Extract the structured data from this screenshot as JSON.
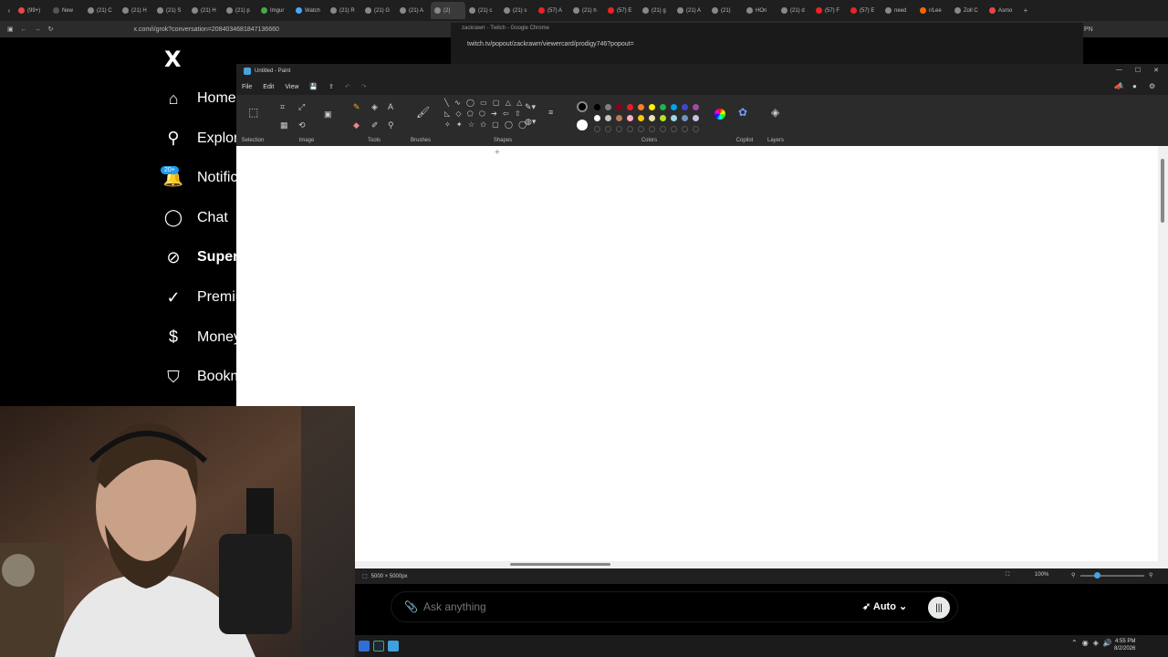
{
  "browser": {
    "tabs": [
      "(99+)",
      "New",
      "(21) C",
      "(21) H",
      "(21) S",
      "(21) H",
      "(21) p",
      "Imgur",
      "Watch",
      "(21) R",
      "(21) G",
      "(21) A",
      "(2)",
      "(21) c",
      "(21) s",
      "(57) A",
      "(21) h",
      "(57) E",
      "(21) g",
      "(21) A",
      "(21)",
      "HOn",
      "(21) d",
      "(57) F",
      "(57) E",
      "need",
      "r/Lee",
      "Zoll C",
      "Asmo"
    ],
    "active_tab_index": 12,
    "url": "x.com/i/grok?conversation=2084034681847136660",
    "profile": "PN"
  },
  "twitch_popout": {
    "title": "zackrawrr - Twitch - Google Chrome",
    "url": "twitch.tv/popout/zackrawrr/viewercard/prodigy746?popout="
  },
  "x_sidebar": {
    "logo": "X",
    "items": [
      {
        "label": "Home",
        "icon": "home-icon"
      },
      {
        "label": "Explor",
        "icon": "search-icon"
      },
      {
        "label": "Notific",
        "icon": "bell-icon"
      },
      {
        "label": "Chat",
        "icon": "chat-icon"
      },
      {
        "label": "Super",
        "icon": "grok-icon"
      },
      {
        "label": "Premiu",
        "icon": "verified-icon"
      },
      {
        "label": "Money",
        "icon": "dollar-icon"
      },
      {
        "label": "Bookm",
        "icon": "bookmark-icon"
      }
    ],
    "notification_badge": "20+"
  },
  "paint": {
    "window_title": "Untitled - Paint",
    "menu": [
      "File",
      "Edit",
      "View"
    ],
    "ribbon_groups": [
      "Selection",
      "Image",
      "Tools",
      "Brushes",
      "Shapes",
      "Colors",
      "Copilot",
      "Layers"
    ],
    "colors": [
      "#000000",
      "#7f7f7f",
      "#880015",
      "#ed1c24",
      "#ff7f27",
      "#fff200",
      "#22b14c",
      "#00a2e8",
      "#3f48cc",
      "#a349a4",
      "#ffffff",
      "#c3c3c3",
      "#b97a57",
      "#ffaec9",
      "#ffc90e",
      "#efe4b0",
      "#b5e61d",
      "#99d9ea",
      "#7092be",
      "#c8bfe7"
    ],
    "canvas_size": "5000 × 5000px",
    "zoom": "100%"
  },
  "grok": {
    "placeholder": "Ask anything",
    "mode": "Auto"
  },
  "taskbar": {
    "time": "4:55 PM",
    "date": "8/2/2026"
  }
}
